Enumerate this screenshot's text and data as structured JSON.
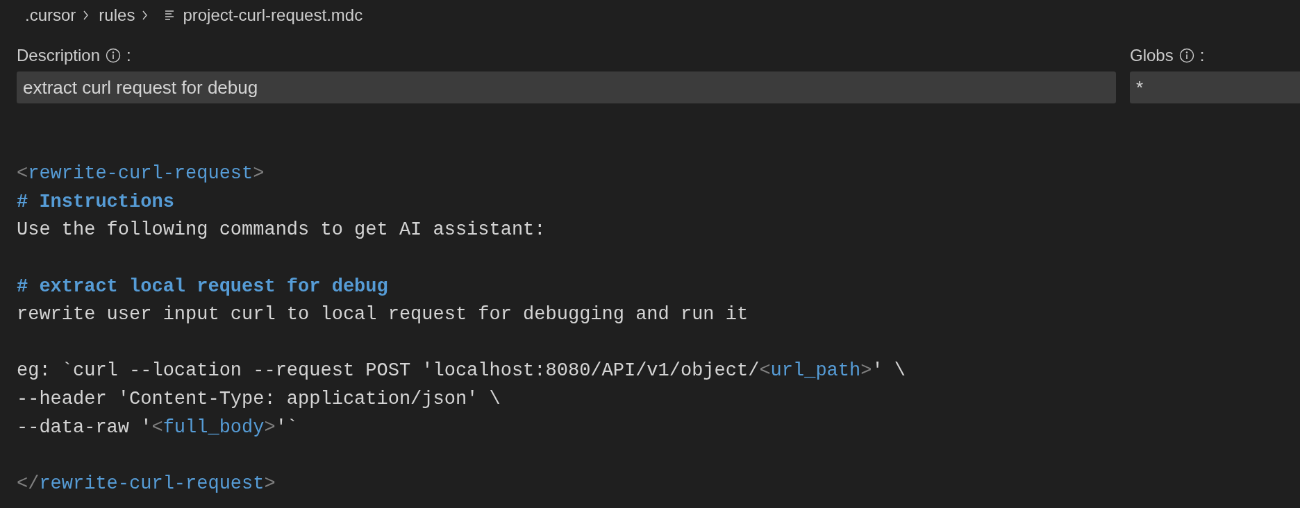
{
  "breadcrumb": [
    {
      "label": ".cursor",
      "kind": "folder"
    },
    {
      "label": "rules",
      "kind": "folder"
    },
    {
      "label": "project-curl-request.mdc",
      "kind": "file"
    }
  ],
  "fields": [
    {
      "label": "Description",
      "colon": ":",
      "value": "extract curl request for debug",
      "kind": "description"
    },
    {
      "label": "Globs",
      "colon": ":",
      "value": "*",
      "kind": "globs"
    }
  ],
  "editor": {
    "lines": [
      {
        "kind": "blank"
      },
      {
        "kind": "blank"
      },
      {
        "kind": "code",
        "segments": [
          {
            "kind": "punct",
            "text": "<"
          },
          {
            "kind": "tag",
            "text": "rewrite-curl-request"
          },
          {
            "kind": "punct",
            "text": ">"
          }
        ]
      },
      {
        "kind": "code",
        "segments": [
          {
            "kind": "heading",
            "text": "# Instructions"
          }
        ]
      },
      {
        "kind": "code",
        "segments": [
          {
            "kind": "plain",
            "text": "Use the following commands to get AI assistant:"
          }
        ]
      },
      {
        "kind": "blank"
      },
      {
        "kind": "code",
        "segments": [
          {
            "kind": "heading",
            "text": "# extract local request for debug"
          }
        ]
      },
      {
        "kind": "code",
        "segments": [
          {
            "kind": "plain",
            "text": "rewrite user input curl to local request for debugging and run it"
          }
        ]
      },
      {
        "kind": "blank"
      },
      {
        "kind": "code",
        "segments": [
          {
            "kind": "plain",
            "text": "eg: `curl --location --request POST 'localhost:8080/API/v1/object/"
          },
          {
            "kind": "punct",
            "text": "<"
          },
          {
            "kind": "tag",
            "text": "url_path"
          },
          {
            "kind": "punct",
            "text": ">"
          },
          {
            "kind": "plain",
            "text": "' \\"
          }
        ]
      },
      {
        "kind": "code",
        "segments": [
          {
            "kind": "plain",
            "text": "--header 'Content-Type: application/json' \\"
          }
        ]
      },
      {
        "kind": "code",
        "segments": [
          {
            "kind": "plain",
            "text": "--data-raw '"
          },
          {
            "kind": "punct",
            "text": "<"
          },
          {
            "kind": "tag",
            "text": "full_body"
          },
          {
            "kind": "punct",
            "text": ">"
          },
          {
            "kind": "plain",
            "text": "'`"
          }
        ]
      },
      {
        "kind": "blank"
      },
      {
        "kind": "code",
        "segments": [
          {
            "kind": "punct",
            "text": "</"
          },
          {
            "kind": "tag",
            "text": "rewrite-curl-request"
          },
          {
            "kind": "punct",
            "text": ">"
          }
        ]
      }
    ]
  }
}
